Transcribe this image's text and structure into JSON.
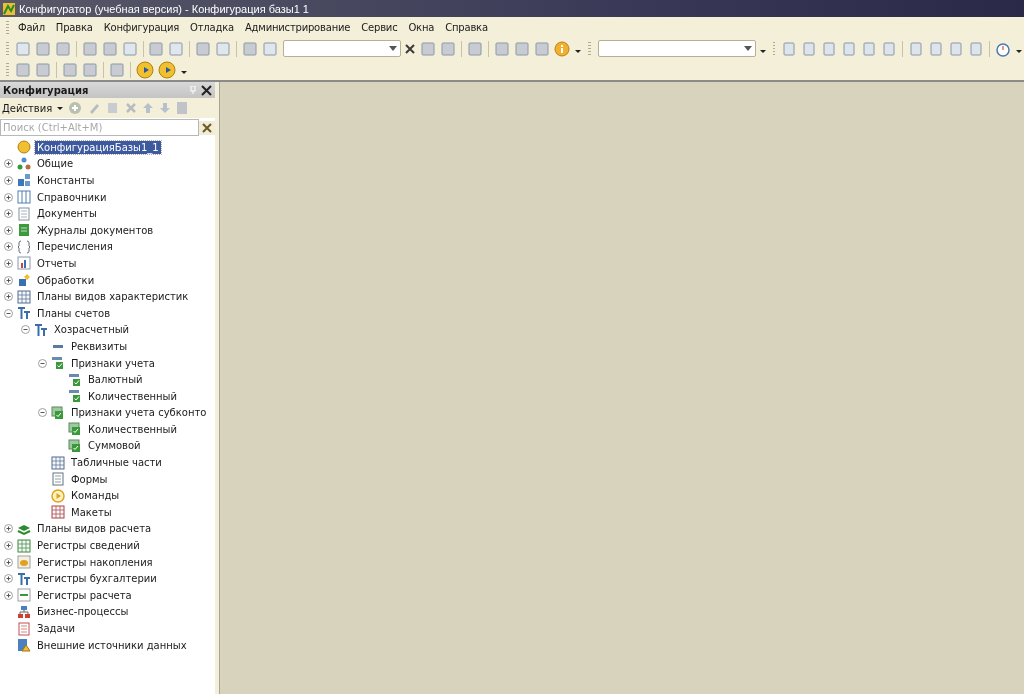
{
  "window": {
    "title": "Конфигуратор (учебная версия) - Конфигурация базы1 1"
  },
  "menu": [
    "Файл",
    "Правка",
    "Конфигурация",
    "Отладка",
    "Администрирование",
    "Сервис",
    "Окна",
    "Справка"
  ],
  "panel": {
    "title": "Конфигурация",
    "actions_label": "Действия",
    "search": {
      "placeholder": "Поиск (Ctrl+Alt+M)"
    },
    "tree": [
      {
        "label": "КонфигурацияБазы1_1",
        "kind": "root",
        "selected": true
      },
      {
        "label": "Общие",
        "kind": "common",
        "expanded": false,
        "selected": false
      },
      {
        "label": "Константы",
        "kind": "constants",
        "expanded": false,
        "selected": false
      },
      {
        "label": "Справочники",
        "kind": "catalogs",
        "expanded": false,
        "selected": false
      },
      {
        "label": "Документы",
        "kind": "documents",
        "expanded": false,
        "selected": false
      },
      {
        "label": "Журналы документов",
        "kind": "journals",
        "expanded": false,
        "selected": false
      },
      {
        "label": "Перечисления",
        "kind": "enums",
        "expanded": false,
        "selected": false
      },
      {
        "label": "Отчеты",
        "kind": "reports",
        "expanded": false,
        "selected": false
      },
      {
        "label": "Обработки",
        "kind": "processing",
        "expanded": false,
        "selected": false
      },
      {
        "label": "Планы видов характеристик",
        "kind": "chartypes",
        "expanded": false,
        "selected": false
      },
      {
        "label": "Планы счетов",
        "kind": "accounts",
        "expanded": true,
        "selected": false,
        "children": [
          {
            "label": "Хозрасчетный",
            "kind": "accounts",
            "expanded": true,
            "selected": false,
            "children": [
              {
                "label": "Реквизиты",
                "kind": "attribute",
                "selected": false
              },
              {
                "label": "Признаки учета",
                "kind": "flag",
                "expanded": true,
                "selected": false,
                "children": [
                  {
                    "label": "Валютный",
                    "kind": "flag",
                    "selected": false
                  },
                  {
                    "label": "Количественный",
                    "kind": "flag",
                    "selected": false
                  }
                ]
              },
              {
                "label": "Признаки учета субконто",
                "kind": "subflag",
                "expanded": true,
                "selected": false,
                "children": [
                  {
                    "label": "Количественный",
                    "kind": "subflag",
                    "selected": false
                  },
                  {
                    "label": "Суммовой",
                    "kind": "subflag",
                    "selected": false
                  }
                ]
              },
              {
                "label": "Табличные части",
                "kind": "tabular",
                "selected": false
              },
              {
                "label": "Формы",
                "kind": "forms",
                "selected": false
              },
              {
                "label": "Команды",
                "kind": "commands",
                "selected": false
              },
              {
                "label": "Макеты",
                "kind": "templates",
                "selected": false
              }
            ]
          }
        ]
      },
      {
        "label": "Планы видов расчета",
        "kind": "calctypes",
        "expanded": false,
        "selected": false
      },
      {
        "label": "Регистры сведений",
        "kind": "inforeg",
        "expanded": false,
        "selected": false
      },
      {
        "label": "Регистры накопления",
        "kind": "accumreg",
        "expanded": false,
        "selected": false
      },
      {
        "label": "Регистры бухгалтерии",
        "kind": "accounts",
        "expanded": false,
        "selected": false
      },
      {
        "label": "Регистры расчета",
        "kind": "calcreg",
        "expanded": false,
        "selected": false
      },
      {
        "label": "Бизнес-процессы",
        "kind": "bizproc",
        "selected": false
      },
      {
        "label": "Задачи",
        "kind": "tasks",
        "selected": false
      },
      {
        "label": "Внешние источники данных",
        "kind": "external",
        "selected": false
      }
    ]
  }
}
